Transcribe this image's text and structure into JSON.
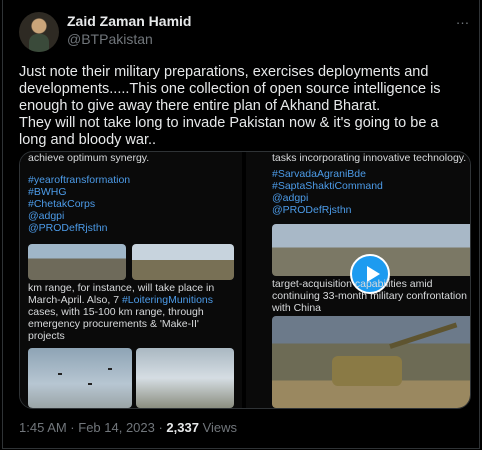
{
  "author": {
    "name": "Zaid Zaman Hamid",
    "handle": "@BTPakistan"
  },
  "more_icon": "…",
  "tweet": {
    "lines": [
      "Just note their military preparations, exercises deployments and developments.....This one collection of open source intelligence is enough to give away there entire plan of Akhand Bharat.",
      "They will not take long to invade Pakistan now & it's going to be a long and bloody war.."
    ]
  },
  "media": {
    "left": {
      "top_text": "achieve optimum synergy.",
      "hashtags": [
        "#yearoftransformation",
        "#BWHG",
        "#ChetakCorps",
        "@adgpi",
        "@PRODefRjsthn"
      ],
      "body_prefix": "km range, for instance, will take place in March-April. Also, 7 ",
      "body_tag": "#LoiteringMunitions",
      "body_suffix": " cases, with 15-100 km range, through emergency procurements & 'Make-II' projects"
    },
    "right": {
      "top_text": "tasks incorporating innovative technology.",
      "hashtags": [
        "#SarvadaAgraniBde",
        "#SaptaShaktiCommand",
        "@adgpi",
        "@PRODefRjsthn"
      ],
      "body": "target-acquisition capabilities amid continuing 33-month military confrontation with China"
    }
  },
  "footer": {
    "time": "1:45 AM · Feb 14, 2023 · ",
    "views_count": "2,337",
    "views_label": " Views"
  }
}
